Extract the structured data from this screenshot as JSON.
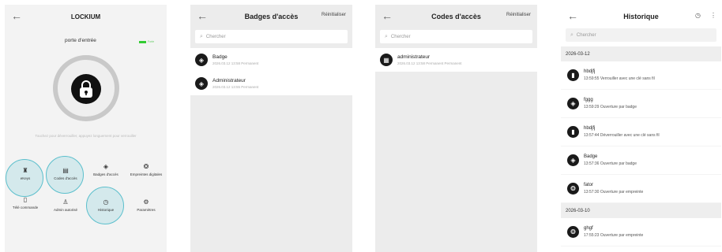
{
  "screen1": {
    "title": "LOCKIUM",
    "door_name": "porte d'entrée",
    "battery": "Forte",
    "hint": "Touchez pour déverrouiller, appuyez longuement pour verrouiller",
    "menu": [
      {
        "label": "eKeys",
        "icon": "key-icon"
      },
      {
        "label": "Codes d'accès",
        "icon": "keypad-icon"
      },
      {
        "label": "Badges d'accès",
        "icon": "badge-icon"
      },
      {
        "label": "Empreintes digitales",
        "icon": "fingerprint-icon"
      },
      {
        "label": "Télé commande",
        "icon": "remote-icon"
      },
      {
        "label": "Admin autorisé",
        "icon": "admin-icon"
      },
      {
        "label": "Historique",
        "icon": "history-icon"
      },
      {
        "label": "Paramètres",
        "icon": "gear-icon"
      }
    ]
  },
  "screen2": {
    "title": "Badges d'accès",
    "action": "Réinitialiser",
    "search_placeholder": "Chercher",
    "items": [
      {
        "name": "Badge",
        "sub": "2026.03.12 13:58 Permanent"
      },
      {
        "name": "Administrateur",
        "sub": "2026.03.12 13:55 Permanent"
      }
    ]
  },
  "screen3": {
    "title": "Codes d'accès",
    "action": "Réinitialiser",
    "search_placeholder": "Chercher",
    "items": [
      {
        "name": "administrateur",
        "sub": "2026.03.12 13:58 Permanent Permanent"
      }
    ]
  },
  "screen4": {
    "title": "Historique",
    "search_placeholder": "Chercher",
    "groups": [
      {
        "date": "2026-03-12",
        "entries": [
          {
            "name": "hbdjfj",
            "detail": "13:59:55 Verrouiller avec une clé sans fil",
            "icon": "remote-icon"
          },
          {
            "name": "fggg",
            "detail": "13:59:29 Ouverture par badge",
            "icon": "badge-icon"
          },
          {
            "name": "hbdjfj",
            "detail": "13:57:44 Déverrouiller avec une clé sans fil",
            "icon": "remote-icon"
          },
          {
            "name": "Badge",
            "detail": "13:57:36 Ouverture par badge",
            "icon": "badge-icon"
          },
          {
            "name": "fator",
            "detail": "13:57:30 Ouverture par empreinte",
            "icon": "fingerprint-icon"
          }
        ]
      },
      {
        "date": "2026-03-10",
        "entries": [
          {
            "name": "ghgf",
            "detail": "17:55:23 Ouverture par empreinte",
            "icon": "fingerprint-icon"
          }
        ]
      }
    ]
  },
  "colors": {
    "highlight": "#5bbfcc",
    "avatar": "#1a1a1a"
  }
}
